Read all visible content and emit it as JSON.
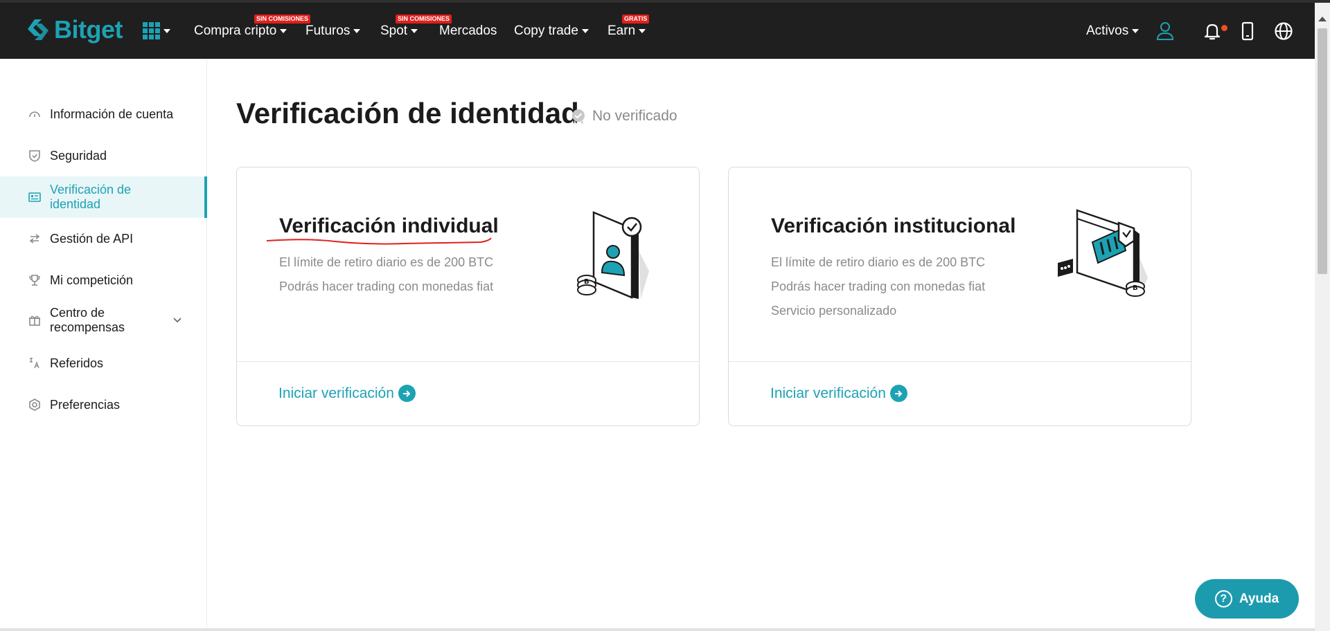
{
  "header": {
    "brand": "Bitget",
    "nav": [
      {
        "label": "Compra cripto",
        "badge": "SIN COMISIONES",
        "dropdown": true
      },
      {
        "label": "Futuros",
        "badge": "",
        "dropdown": true
      },
      {
        "label": "Spot",
        "badge": "SIN COMISIONES",
        "dropdown": true
      },
      {
        "label": "Mercados",
        "badge": "",
        "dropdown": false
      },
      {
        "label": "Copy trade",
        "badge": "",
        "dropdown": true
      },
      {
        "label": "Earn",
        "badge": "GRATIS",
        "dropdown": true
      }
    ],
    "assets_label": "Activos",
    "icons": [
      "user-icon",
      "bell-icon",
      "mobile-icon",
      "globe-icon"
    ],
    "has_unread_notifications": true
  },
  "sidebar": {
    "items": [
      {
        "label": "Información de cuenta",
        "icon": "dashboard-icon"
      },
      {
        "label": "Seguridad",
        "icon": "shield-icon"
      },
      {
        "label": "Verificación de identidad",
        "icon": "id-card-icon",
        "active": true
      },
      {
        "label": "Gestión de API",
        "icon": "api-icon"
      },
      {
        "label": "Mi competición",
        "icon": "trophy-icon"
      },
      {
        "label": "Centro de recompensas",
        "icon": "gift-icon",
        "expandable": true
      },
      {
        "label": "Referidos",
        "icon": "referral-icon"
      },
      {
        "label": "Preferencias",
        "icon": "settings-hex-icon"
      }
    ]
  },
  "main": {
    "title": "Verificación de identidad",
    "status": "No verificado",
    "cards": [
      {
        "title": "Verificación individual",
        "lines": [
          "El límite de retiro diario es de 200 BTC",
          "Podrás hacer trading con monedas fiat"
        ],
        "link": "Iniciar verificación"
      },
      {
        "title": "Verificación institucional",
        "lines": [
          "El límite de retiro diario es de 200 BTC",
          "Podrás hacer trading con monedas fiat",
          "Servicio personalizado"
        ],
        "link": "Iniciar verificación"
      }
    ]
  },
  "help": {
    "label": "Ayuda"
  },
  "colors": {
    "accent": "#1da2b4",
    "header_bg": "#1f1f1f",
    "badge": "#e0201b",
    "annotation": "#e0201b"
  }
}
